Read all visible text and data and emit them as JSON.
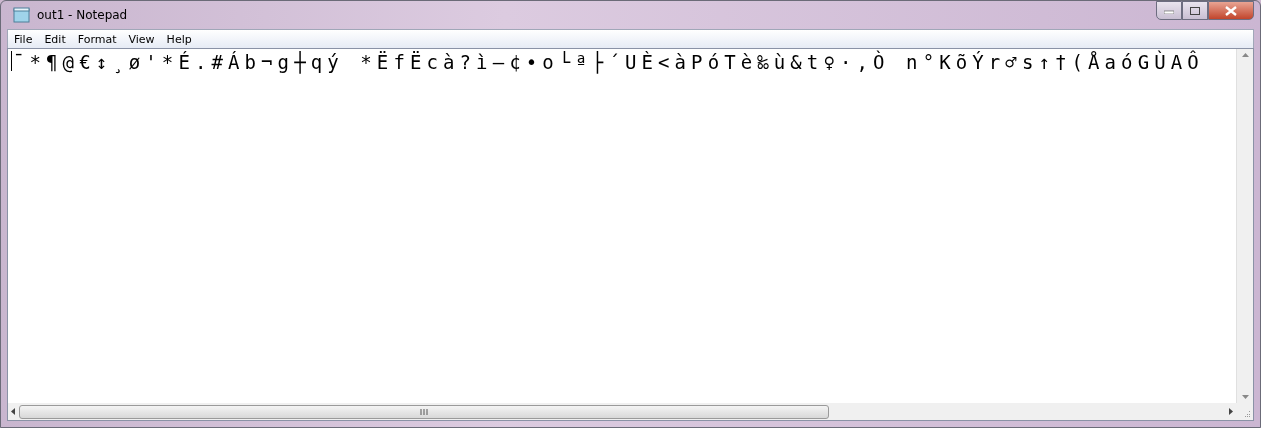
{
  "window": {
    "title": "out1 - Notepad"
  },
  "menu": [
    {
      "label": "File"
    },
    {
      "label": "Edit"
    },
    {
      "label": "Format"
    },
    {
      "label": "View"
    },
    {
      "label": "Help"
    }
  ],
  "document": {
    "text": "ˉ*¶@€↕¸ø'*É.#Áb¬g┼qý *ËfËcà?ì–¢•o└ª├´UÈ<àPóTè‰ù&t♀·,Ò n°KõÝr♂s↑†(ÅaóGÙAÔ"
  }
}
